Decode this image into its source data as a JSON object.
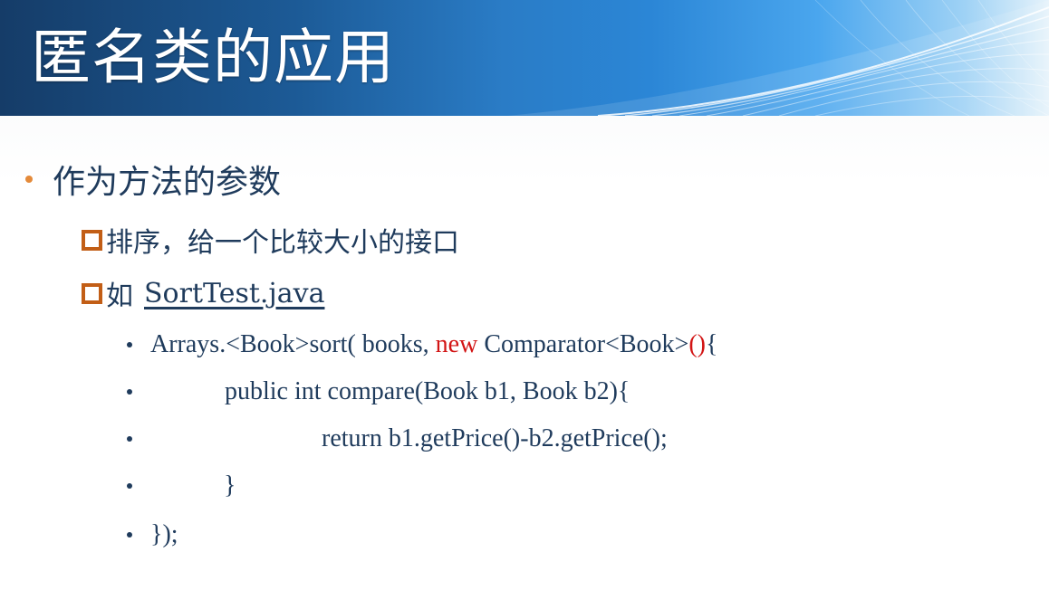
{
  "slide": {
    "title": "匿名类的应用",
    "level1": {
      "text": "作为方法的参数"
    },
    "level2": [
      {
        "text": "排序，给一个比较大小的接口"
      },
      {
        "text": "如",
        "link": "SortTest.java"
      }
    ],
    "code_lines": [
      {
        "before": "Arrays.<Book>sort( books, ",
        "keyword": "new",
        "middle": " Comparator<Book>",
        "parens": "()",
        "after": "{"
      },
      {
        "text": "public int compare(Book b1, Book b2){"
      },
      {
        "text": "return b1.getPrice()-b2.getPrice();"
      },
      {
        "text": "}"
      },
      {
        "text": "});"
      }
    ]
  },
  "colors": {
    "title_text": "#ffffff",
    "body_text": "#1f3b5c",
    "bullet_orange": "#e48a3a",
    "square_bullet": "#c25e16",
    "keyword_red": "#d21414"
  }
}
